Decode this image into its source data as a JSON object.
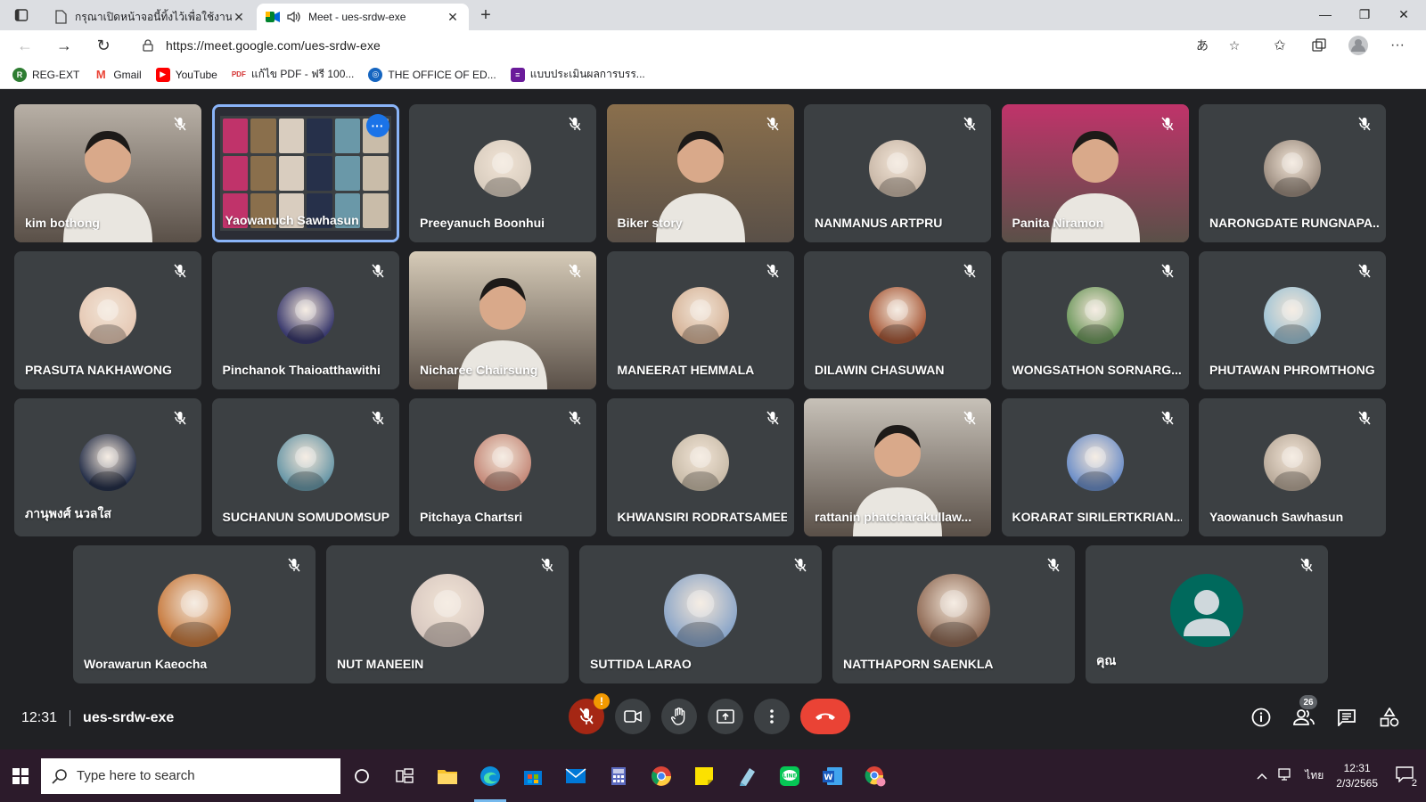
{
  "browser": {
    "tabs": [
      {
        "title": "กรุณาเปิดหน้าจอนี้ทิ้งไว้เพื่อใช้งาน Inte",
        "active": false
      },
      {
        "title": "Meet - ues-srdw-exe",
        "active": true
      }
    ],
    "new_tab_label": "+",
    "window_controls": {
      "minimize": "—",
      "restore": "❐",
      "close": "✕"
    },
    "address": {
      "url": "https://meet.google.com/ues-srdw-exe"
    },
    "bookmarks": [
      {
        "label": "REG-EXT",
        "icon": "reg-icon",
        "color": "#2e7d32"
      },
      {
        "label": "Gmail",
        "icon": "gmail-icon",
        "color": "#ea4335"
      },
      {
        "label": "YouTube",
        "icon": "youtube-icon",
        "color": "#ff0000"
      },
      {
        "label": "แก้ไข PDF - ฟรี 100...",
        "icon": "pdf-icon",
        "color": "#d32f2f"
      },
      {
        "label": "THE OFFICE OF ED...",
        "icon": "office-icon",
        "color": "#1565c0"
      },
      {
        "label": "แบบประเมินผลการบรร...",
        "icon": "form-icon",
        "color": "#6a1b9a"
      }
    ]
  },
  "participants": [
    {
      "name": "kim bothong",
      "type": "video",
      "bg": "#b8b0a6"
    },
    {
      "name": "Yaowanuch Sawhasun",
      "type": "screen",
      "bg": "#2b2d35",
      "selected": true
    },
    {
      "name": "Preeyanuch Boonhui",
      "type": "avatar",
      "bg": "#d9cdbf"
    },
    {
      "name": "Biker story",
      "type": "video",
      "bg": "#8a6f4c"
    },
    {
      "name": "NANMANUS ARTPRU",
      "type": "avatar",
      "bg": "#c9b8a8"
    },
    {
      "name": "Panita Niramon",
      "type": "video",
      "bg": "#c0336a"
    },
    {
      "name": "NARONGDATE RUNGNAPA...",
      "type": "avatar",
      "bg": "#9c8d80"
    },
    {
      "name": "PRASUTA NAKHAWONG",
      "type": "avatar",
      "bg": "#e6c9b5"
    },
    {
      "name": "Pinchanok Thaioatthawithi",
      "type": "avatar",
      "bg": "#3a3a6e"
    },
    {
      "name": "Nicharee Chairsung",
      "type": "video",
      "bg": "#d6cbb8"
    },
    {
      "name": "MANEERAT HEMMALA",
      "type": "avatar",
      "bg": "#d7b59a"
    },
    {
      "name": "DILAWIN CHASUWAN",
      "type": "avatar",
      "bg": "#a85a3a"
    },
    {
      "name": "WONGSATHON SORNARG...",
      "type": "avatar",
      "bg": "#6f9a5f"
    },
    {
      "name": "PHUTAWAN PHROMTHONG",
      "type": "avatar",
      "bg": "#9fc4d6"
    },
    {
      "name": "ภานุพงศ์ นวลใส",
      "type": "avatar",
      "bg": "#26304a"
    },
    {
      "name": "SUCHANUN SOMUDOMSUP",
      "type": "avatar",
      "bg": "#6a98a8"
    },
    {
      "name": "Pitchaya Chartsri",
      "type": "avatar",
      "bg": "#c58a7a"
    },
    {
      "name": "KHWANSIRI RODRATSAMEE",
      "type": "avatar",
      "bg": "#c9bca9"
    },
    {
      "name": "rattanin phatcharakullaw...",
      "type": "video",
      "bg": "#c7c1b8"
    },
    {
      "name": "KORARAT SIRILERTKRIAN...",
      "type": "avatar",
      "bg": "#6d8fc9"
    },
    {
      "name": "Yaowanuch Sawhasun",
      "type": "avatar",
      "bg": "#b9aa9a"
    },
    {
      "name": "Worawarun Kaeocha",
      "type": "avatar",
      "bg": "#c77a3e"
    },
    {
      "name": "NUT MANEEIN",
      "type": "avatar",
      "bg": "#d9c9c1"
    },
    {
      "name": "SUTTIDA LARAO",
      "type": "avatar",
      "bg": "#8ba6c9"
    },
    {
      "name": "NATTHAPORN SAENKLA",
      "type": "avatar",
      "bg": "#8f6a55"
    },
    {
      "name": "คุณ",
      "type": "placeholder",
      "bg": "#00695c"
    }
  ],
  "meeting": {
    "time": "12:31",
    "code": "ues-srdw-exe",
    "mic_alert": "!",
    "people_count": "26"
  },
  "taskbar": {
    "search_placeholder": "Type here to search",
    "clock_time": "12:31",
    "clock_date": "2/3/2565",
    "lang": "ไทย",
    "notifications": "2"
  }
}
